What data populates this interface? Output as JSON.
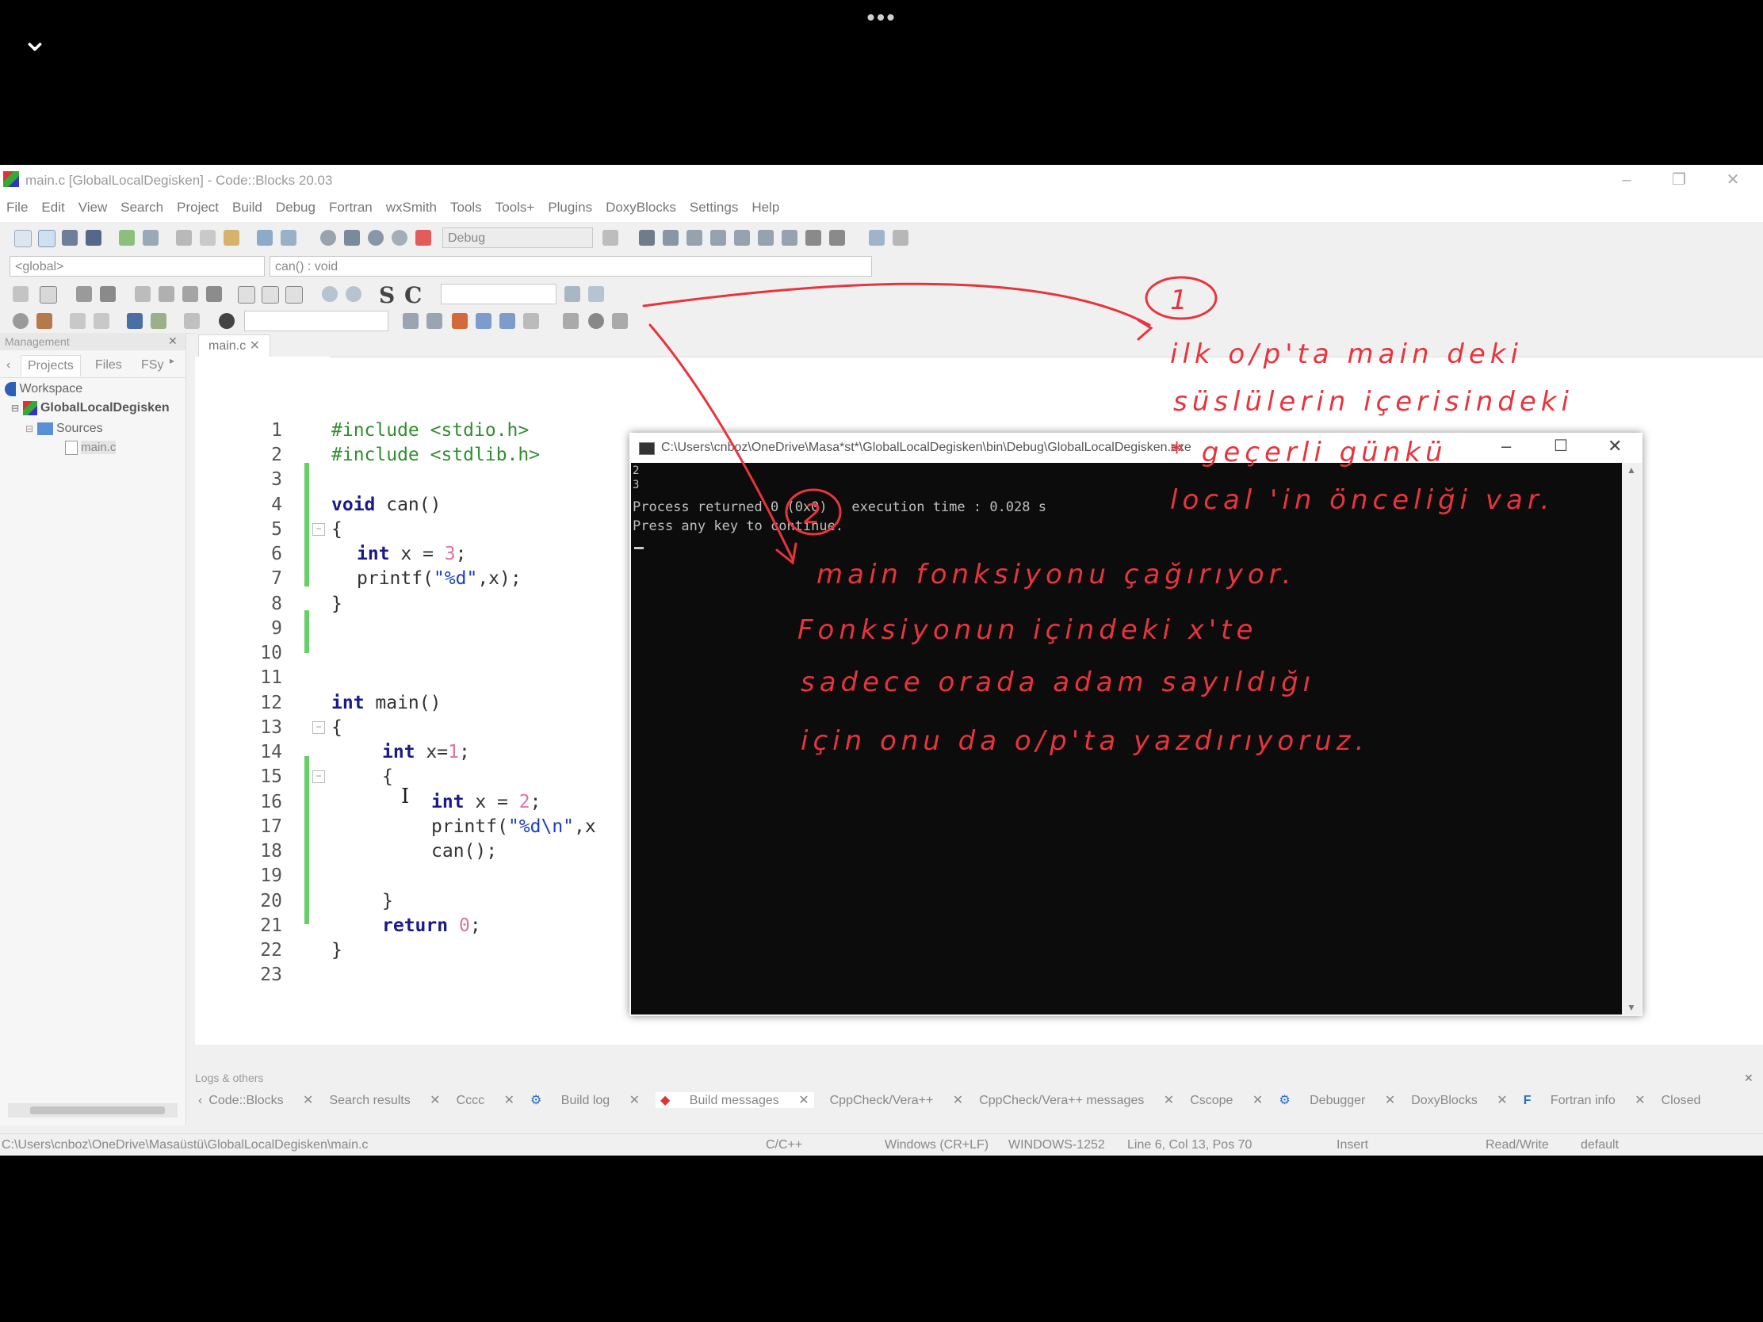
{
  "viewer": {
    "back_icon": "chevron-down-icon",
    "more_icon": "more-dots-icon"
  },
  "window": {
    "title": "main.c [GlobalLocalDegisken] - Code::Blocks 20.03"
  },
  "menu": [
    "File",
    "Edit",
    "View",
    "Search",
    "Project",
    "Build",
    "Debug",
    "Fortran",
    "wxSmith",
    "Tools",
    "Tools+",
    "Plugins",
    "DoxyBlocks",
    "Settings",
    "Help"
  ],
  "toolbar": {
    "build_target": "Debug",
    "scope": "<global>",
    "function": "can() : void",
    "s_label": "S",
    "c_label": "C"
  },
  "management": {
    "title": "Management",
    "tabs": [
      "Projects",
      "Files",
      "FSy"
    ],
    "tree": {
      "workspace": "Workspace",
      "project": "GlobalLocalDegisken",
      "folder": "Sources",
      "file": "main.c"
    }
  },
  "editor": {
    "tab": "main.c",
    "line_numbers": [
      "1",
      "2",
      "3",
      "4",
      "5",
      "6",
      "7",
      "8",
      "9",
      "10",
      "11",
      "12",
      "13",
      "14",
      "15",
      "16",
      "17",
      "18",
      "19",
      "20",
      "21",
      "22",
      "23"
    ],
    "lines": {
      "l1": "#include <stdio.h>",
      "l2": "#include <stdlib.h>",
      "l4a": "void",
      "l4b": " can()",
      "l5": "{",
      "l6a": "int",
      "l6b": " x = ",
      "l6c": "3",
      "l6d": ";",
      "l7a": "printf(",
      "l7b": "\"%d\"",
      "l7c": ",x);",
      "l8": "}",
      "l12a": "int",
      "l12b": " main()",
      "l13": "{",
      "l14a": "int",
      "l14b": " x=",
      "l14c": "1",
      "l14d": ";",
      "l15": "{",
      "l16a": "int",
      "l16b": " x = ",
      "l16c": "2",
      "l16d": ";",
      "l17a": "printf(",
      "l17b": "\"%d\\n\"",
      "l17c": ",x",
      "l18": "can();",
      "l20": "}",
      "l21a": "return",
      "l21b": " ",
      "l21c": "0",
      "l21d": ";",
      "l22": "}"
    }
  },
  "console": {
    "title": "C:\\Users\\cnboz\\OneDrive\\Masa*st*\\GlobalLocalDegisken\\bin\\Debug\\GlobalLocalDegisken.exe",
    "output_lines": [
      "2",
      "3",
      "Process returned 0 (0x0)   execution time : 0.028 s",
      "Press any key to continue."
    ]
  },
  "logs": {
    "title": "Logs & others",
    "tabs": [
      "Code::Blocks",
      "Search results",
      "Cccc",
      "Build log",
      "Build messages",
      "CppCheck/Vera++",
      "CppCheck/Vera++ messages",
      "Cscope",
      "Debugger",
      "DoxyBlocks",
      "Fortran info",
      "Closed"
    ]
  },
  "status": {
    "path": "C:\\Users\\cnboz\\OneDrive\\Masaüstü\\GlobalLocalDegisken\\main.c",
    "lang": "C/C++",
    "eol": "Windows (CR+LF)",
    "encoding": "WINDOWS-1252",
    "position": "Line 6, Col 13, Pos 70",
    "mode": "Insert",
    "access": "Read/Write",
    "profile": "default"
  },
  "annotations": {
    "n1": "1",
    "n2": "2",
    "note1": [
      "ilk o/p'ta main deki",
      "süslülerin içerisindeki",
      "* geçerli günkü",
      "local 'in önceliği var."
    ],
    "note2": [
      "main fonksiyonu çağırıyor.",
      "Fonksiyonun içindeki x'te",
      "sadece orada adam sayıldığı",
      "için onu da o/p'ta yazdırıyoruz."
    ],
    "ink_color": "#e8343c"
  },
  "colors": {
    "keyword": "#1a1a8a",
    "preprocessor": "#2f8f2f",
    "string": "#1a3fbf",
    "number": "#e070a0",
    "change_bar": "#66d066"
  }
}
